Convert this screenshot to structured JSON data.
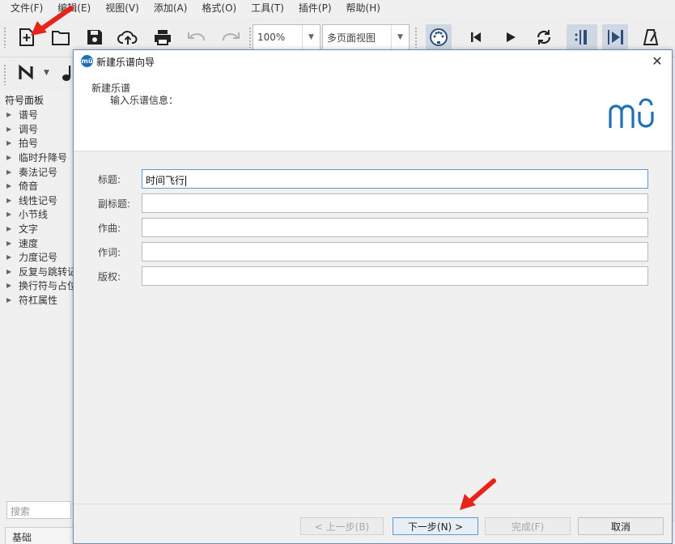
{
  "menu": [
    "文件(F)",
    "编辑(E)",
    "视图(V)",
    "添加(A)",
    "格式(O)",
    "工具(T)",
    "插件(P)",
    "帮助(H)"
  ],
  "toolbar": {
    "zoom_value": "100%",
    "view_mode": "多页面视图"
  },
  "palette": {
    "title": "符号面板",
    "items": [
      "谱号",
      "调号",
      "拍号",
      "临时升降号",
      "奏法记号",
      "倚音",
      "线性记号",
      "小节线",
      "文字",
      "速度",
      "力度记号",
      "反复与跳转记号",
      "换行符与占位符",
      "符杠属性"
    ],
    "search_placeholder": "搜索",
    "workspace": "基础"
  },
  "dialog": {
    "title": "新建乐谱向导",
    "header_title": "新建乐谱",
    "header_subtitle": "输入乐谱信息：",
    "logo_text": "mū",
    "fields": [
      {
        "label": "标题:",
        "value": "时间飞行"
      },
      {
        "label": "副标题:",
        "value": ""
      },
      {
        "label": "作曲:",
        "value": ""
      },
      {
        "label": "作词:",
        "value": ""
      },
      {
        "label": "版权:",
        "value": ""
      }
    ],
    "buttons": {
      "back": "< 上一步(B)",
      "next": "下一步(N) >",
      "finish": "完成(F)",
      "cancel": "取消"
    }
  },
  "colors": {
    "accent": "#1f6fb8",
    "annotation_arrow": "#e8231a"
  }
}
